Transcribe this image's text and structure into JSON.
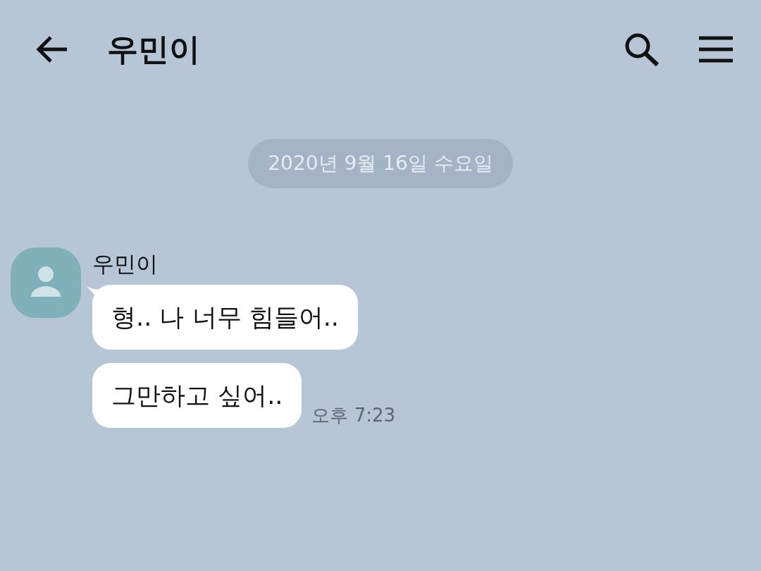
{
  "header": {
    "title": "우민이"
  },
  "date_divider": "2020년 9월 16일 수요일",
  "message_group": {
    "sender": "우민이",
    "bubbles": [
      {
        "text": "형.. 나 너무 힘들어.."
      },
      {
        "text": "그만하고 싶어.."
      }
    ],
    "time": "오후 7:23"
  }
}
